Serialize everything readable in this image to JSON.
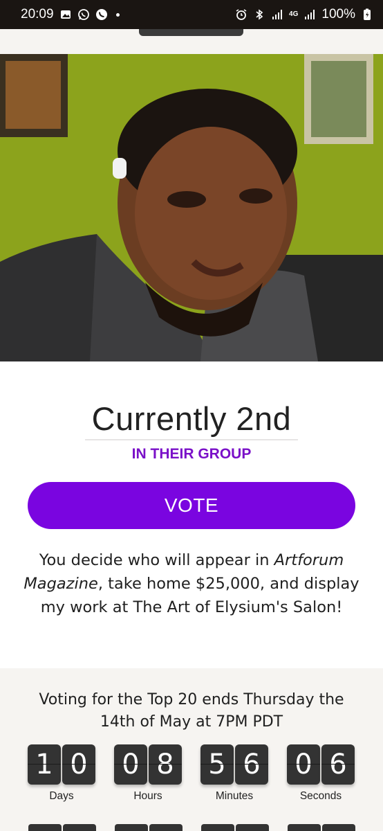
{
  "status_bar": {
    "time": "20:09",
    "network": "4G",
    "battery": "100%",
    "icons": [
      "image-icon",
      "whatsapp-icon",
      "viber-icon",
      "alarm-icon",
      "bluetooth-icon",
      "signal-icon",
      "battery-icon"
    ]
  },
  "photo": {
    "subject": "profile-photo"
  },
  "rank": {
    "title": "Currently 2nd",
    "subtitle": "IN THEIR GROUP"
  },
  "vote_button": {
    "label": "VOTE"
  },
  "promo": {
    "part1": "You decide who will appear in ",
    "italic": "Artforum Magazine",
    "part2": ", take home $25,000, and display my work at The Art of Elysium's Salon!"
  },
  "countdown": {
    "title": "Voting for the Top 20 ends Thursday the 14th of May at 7PM PDT",
    "units": [
      {
        "digits": [
          "1",
          "0"
        ],
        "label": "Days"
      },
      {
        "digits": [
          "0",
          "8"
        ],
        "label": "Hours"
      },
      {
        "digits": [
          "5",
          "6"
        ],
        "label": "Minutes"
      },
      {
        "digits": [
          "0",
          "6"
        ],
        "label": "Seconds"
      }
    ]
  },
  "colors": {
    "accent": "#7a05e0",
    "subtitle": "#7a10c8",
    "status_bar": "#1a1512",
    "digit_tile": "#333333"
  }
}
